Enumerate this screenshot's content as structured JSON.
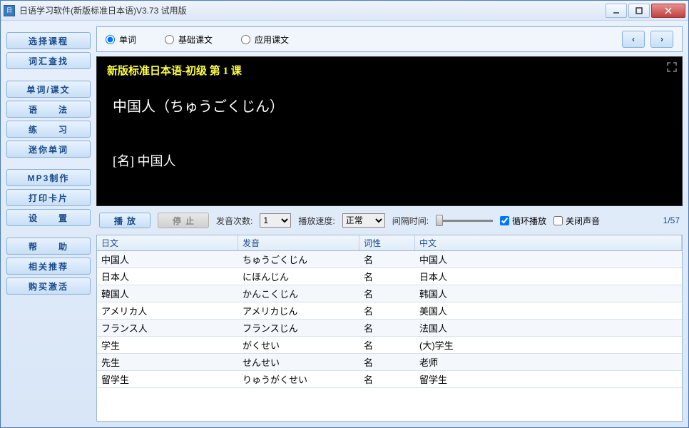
{
  "window": {
    "title": "日语学习软件(新版标准日本语)V3.73 试用版"
  },
  "sidebar": {
    "groups": [
      {
        "items": [
          {
            "label": "选择课程"
          },
          {
            "label": "词汇查找"
          }
        ]
      },
      {
        "items": [
          {
            "label": "单词/课文"
          },
          {
            "label": "语　　法"
          },
          {
            "label": "练　　习"
          },
          {
            "label": "迷你单词"
          }
        ]
      },
      {
        "items": [
          {
            "label": "MP3制作"
          },
          {
            "label": "打印卡片"
          },
          {
            "label": "设　　置"
          }
        ]
      },
      {
        "items": [
          {
            "label": "帮　　助"
          },
          {
            "label": "相关推荐"
          },
          {
            "label": "购买激活"
          }
        ]
      }
    ]
  },
  "radios": [
    {
      "label": "单词",
      "checked": true
    },
    {
      "label": "基础课文",
      "checked": false
    },
    {
      "label": "应用课文",
      "checked": false
    }
  ],
  "display": {
    "lesson": "新版标准日本语-初级 第 1 课",
    "word": "中国人（ちゅうごくじん）",
    "meaning": "[名] 中国人"
  },
  "controls": {
    "play": "播放",
    "stop": "停止",
    "count_label": "发音次数:",
    "count_value": "1",
    "speed_label": "播放速度:",
    "speed_value": "正常",
    "interval_label": "间隔时间:",
    "loop_label": "循环播放",
    "loop_checked": true,
    "mute_label": "关闭声音",
    "mute_checked": false,
    "position": "1/57"
  },
  "table": {
    "headers": {
      "jp": "日文",
      "pron": "发音",
      "pos": "词性",
      "cn": "中文"
    },
    "rows": [
      {
        "jp": "中国人",
        "pron": "ちゅうごくじん",
        "pos": "名",
        "cn": "中国人"
      },
      {
        "jp": "日本人",
        "pron": "にほんじん",
        "pos": "名",
        "cn": "日本人"
      },
      {
        "jp": "韓国人",
        "pron": "かんこくじん",
        "pos": "名",
        "cn": "韩国人"
      },
      {
        "jp": "アメリカ人",
        "pron": "アメリカじん",
        "pos": "名",
        "cn": "美国人"
      },
      {
        "jp": "フランス人",
        "pron": "フランスじん",
        "pos": "名",
        "cn": "法国人"
      },
      {
        "jp": "学生",
        "pron": "がくせい",
        "pos": "名",
        "cn": "(大)学生"
      },
      {
        "jp": "先生",
        "pron": "せんせい",
        "pos": "名",
        "cn": "老师"
      },
      {
        "jp": "留学生",
        "pron": "りゅうがくせい",
        "pos": "名",
        "cn": "留学生"
      }
    ]
  }
}
